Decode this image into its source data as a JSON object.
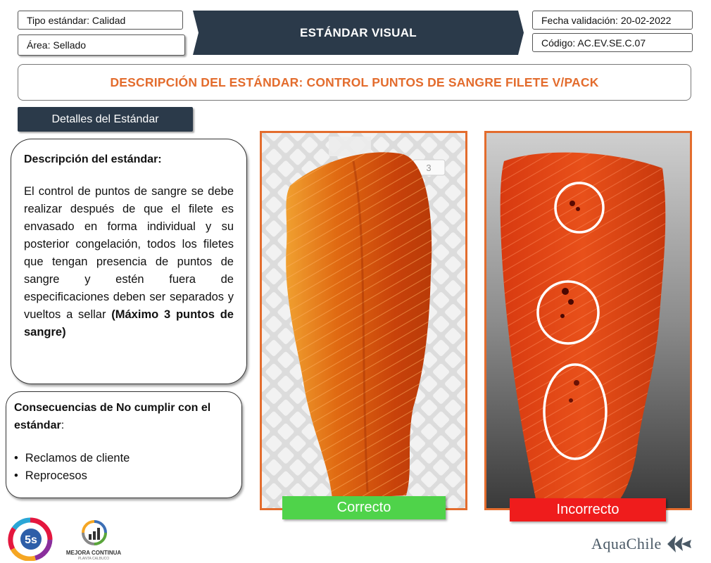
{
  "header": {
    "tipo_estandar": "Tipo estándar: Calidad",
    "area": "Área: Sellado",
    "banner_title": "ESTÁNDAR VISUAL",
    "fecha_validacion": "Fecha validación: 20-02-2022",
    "codigo": "Código: AC.EV.SE.C.07"
  },
  "description_title": "DESCRIPCIÓN DEL ESTÁNDAR: CONTROL PUNTOS DE SANGRE FILETE V/PACK",
  "details_button": "Detalles del Estándar",
  "descripcion": {
    "heading": "Descripción del estándar:",
    "body": "El control de puntos de sangre se debe realizar después de que el filete es envasado en forma individual y su posterior congelación, todos los filetes que tengan presencia de puntos de sangre y estén fuera de especificaciones deben ser separados y vueltos a sellar",
    "body_bold": "(Máximo 3 puntos de sangre)"
  },
  "consecuencias": {
    "heading_bold": "Consecuencias de No cumplir con el estándar",
    "heading_suffix": ":",
    "items": [
      "Reclamos de cliente",
      "Reprocesos"
    ]
  },
  "photos": {
    "correct_tag_number": "3"
  },
  "labels": {
    "correct": "Correcto",
    "incorrect": "Incorrecto"
  },
  "logos": {
    "five_s": "5s",
    "mejora_continua": "MEJORA CONTINUA",
    "mejora_sub": "PLANTA CALBUCO",
    "brand": "AquaChile"
  },
  "colors": {
    "accent_orange": "#e36c2d",
    "banner_dark": "#2b3a4a",
    "correct_green": "#4fd34a",
    "incorrect_red": "#ef1c1c"
  }
}
